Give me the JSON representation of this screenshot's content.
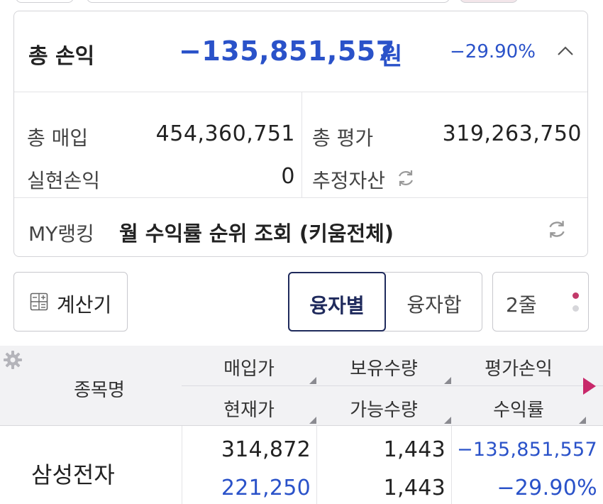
{
  "summary": {
    "total_pl_label": "총 손익",
    "total_pl_value": "−135,851,557",
    "total_pl_unit": "원",
    "total_pl_rate": "−29.90%",
    "total_purchase_label": "총 매입",
    "total_purchase_value": "454,360,751",
    "total_eval_label": "총 평가",
    "total_eval_value": "319,263,750",
    "realized_pl_label": "실현손익",
    "realized_pl_value": "0",
    "est_assets_label": "추정자산",
    "ranking_label": "MY랭킹",
    "ranking_text": "월 수익률 순위 조회 (키움전체)"
  },
  "toolbar": {
    "calculator_label": "계산기",
    "segments": [
      "융자별",
      "융자합"
    ],
    "lines_label": "2줄"
  },
  "table": {
    "headers": {
      "name": "종목명",
      "purchase_price": "매입가",
      "holding_qty": "보유수량",
      "eval_pl": "평가손익",
      "current_price": "현재가",
      "available_qty": "가능수량",
      "return_rate": "수익률"
    },
    "rows": [
      {
        "name": "삼성전자",
        "purchase_price": "314,872",
        "holding_qty": "1,443",
        "eval_pl": "−135,851,557",
        "current_price": "221,250",
        "available_qty": "1,443",
        "return_rate": "−29.90%"
      }
    ]
  },
  "colors": {
    "loss_blue": "#2a52c9",
    "active_navy": "#1f2a5c",
    "accent_red": "#c8286a"
  }
}
